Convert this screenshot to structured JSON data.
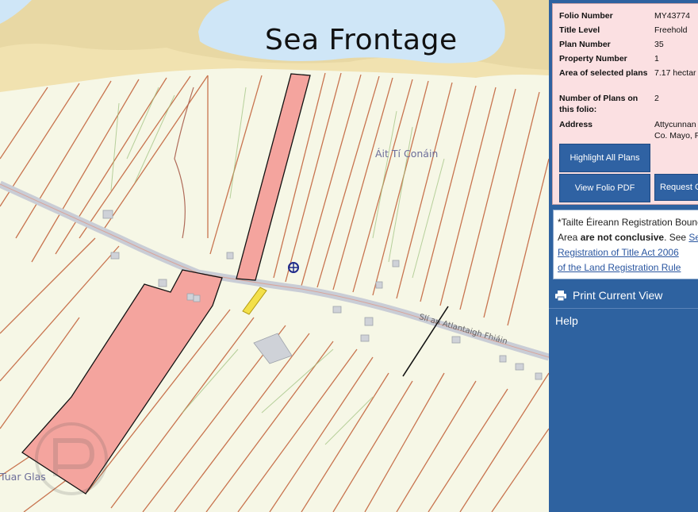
{
  "map": {
    "title": "Sea Frontage",
    "places": [
      {
        "id": "ait-ti-conain",
        "label": "Áit Tí Conáin"
      },
      {
        "id": "tuar-glas",
        "label": "Tuar Glas"
      }
    ],
    "road_label": "Slí an Atlantaigh Fhiáin",
    "colors": {
      "sea": "#cfe6f7",
      "beach": "#f1e2b0",
      "land": "#f6f7e6",
      "parcel_line": "#c8744f",
      "selected_fill": "#f4a49e",
      "road": "#c9cdd6"
    }
  },
  "folio": {
    "rows": [
      {
        "key": "Folio Number",
        "value": "MY43774"
      },
      {
        "key": "Title Level",
        "value": "Freehold"
      },
      {
        "key": "Plan Number",
        "value": "35"
      },
      {
        "key": "Property Number",
        "value": "1"
      },
      {
        "key": "Area of selected plans",
        "value": "7.17 hectar"
      },
      {
        "key": "Number of Plans on this folio:",
        "value": "2"
      },
      {
        "key": "Address",
        "value": "Attycunnan"
      },
      {
        "key": "",
        "value": "Co. Mayo, F"
      }
    ],
    "buttons": {
      "highlight": "Highlight All Plans",
      "view_pdf": "View Folio PDF",
      "request": "Request C"
    }
  },
  "notice": {
    "line1": "*Tailte Éireann Registration Bounc",
    "line2_pre": "Area ",
    "line2_bold": "are not conclusive",
    "line2_post": ". See ",
    "line2_link": "Sec",
    "line3_link": "Registration of Title Act 2006",
    "line4_link": "of the Land Registration Rule"
  },
  "sidebar": {
    "print": "Print Current View",
    "print_icon": "printer-icon",
    "help": "Help"
  }
}
